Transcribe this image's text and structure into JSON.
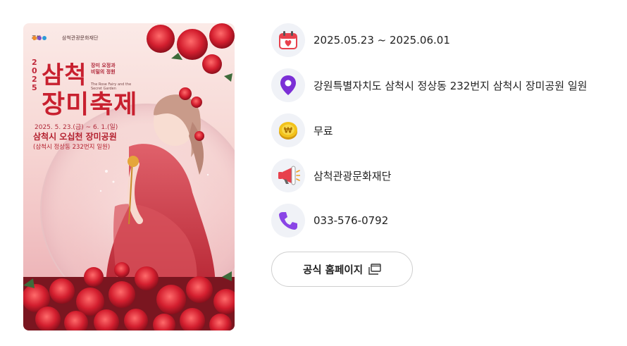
{
  "poster": {
    "host_label": "주최",
    "org_name": "삼척관광문화재단",
    "year": "2025",
    "title_line1": "삼척",
    "title_line2": "장미축제",
    "subtitle": "장미 요정과 비밀의 정원",
    "subtitle_en": "The Rose Fairy and the Secret Garden",
    "dates": "2025. 5. 23.(금) ~ 6. 1.(일)",
    "venue": "삼척시 오십천 장미공원",
    "address": "(삼척시 정상동 232번지 일원)"
  },
  "info": {
    "period": "2025.05.23 ~ 2025.06.01",
    "location": "강원특별자치도 삼척시 정상동 232번지 삼척시 장미공원 일원",
    "fee": "무료",
    "organizer": "삼척관광문화재단",
    "phone": "033-576-0792"
  },
  "icons": {
    "calendar": "calendar-icon",
    "location": "map-pin-icon",
    "fee": "won-coin-icon",
    "organizer": "megaphone-icon",
    "phone": "phone-icon"
  },
  "homepage_button": {
    "label": "공식 홈페이지"
  },
  "colors": {
    "icon_bg": "#f0f2f7",
    "pin": "#7b2fd6",
    "phone": "#8a45e6",
    "coin": "#f2c21b",
    "calendar_red": "#e8414d"
  }
}
